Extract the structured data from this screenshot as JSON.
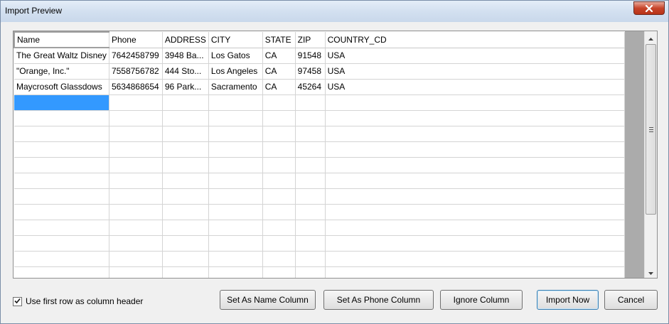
{
  "window": {
    "title": "Import Preview"
  },
  "grid": {
    "columns": [
      "Name",
      "Phone",
      "ADDRESS",
      "CITY",
      "STATE",
      "ZIP",
      "COUNTRY_CD"
    ],
    "rows": [
      [
        "The Great Waltz Disney",
        "7642458799",
        "3948 Ba...",
        "Los Gatos",
        "CA",
        "91548",
        "USA"
      ],
      [
        "\"Orange, Inc.\"",
        "7558756782",
        "444 Sto...",
        "Los Angeles",
        "CA",
        "97458",
        "USA"
      ],
      [
        "Maycrosoft Glassdows",
        "5634868654",
        "96 Park...",
        "Sacramento",
        "CA",
        "45264",
        "USA"
      ]
    ],
    "empty_rows": 12
  },
  "options": {
    "first_row_header_label": "Use first row as column header",
    "first_row_header_checked": true
  },
  "buttons": {
    "set_name": "Set As Name Column",
    "set_phone": "Set As Phone Column",
    "ignore": "Ignore Column",
    "import_now": "Import Now",
    "cancel": "Cancel"
  },
  "icons": {
    "close": "close-icon",
    "scroll_up": "arrow-up-icon",
    "scroll_down": "arrow-down-icon",
    "check": "checkmark-icon"
  },
  "colors": {
    "selection": "#3399ff",
    "close_button": "#c7452b"
  }
}
